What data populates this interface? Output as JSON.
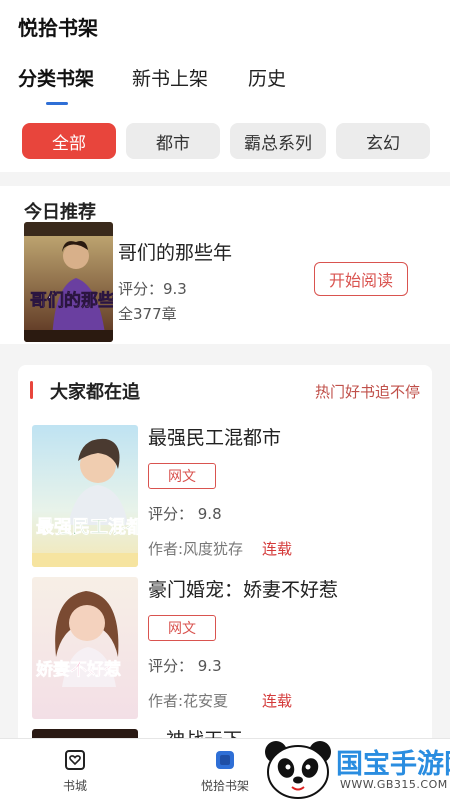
{
  "app": {
    "title": "悦拾书架"
  },
  "tabs": [
    {
      "label": "分类书架",
      "active": true
    },
    {
      "label": "新书上架",
      "active": false
    },
    {
      "label": "历史",
      "active": false
    }
  ],
  "categories": [
    {
      "label": "全部",
      "active": true
    },
    {
      "label": "都市",
      "active": false
    },
    {
      "label": "霸总系列",
      "active": false
    },
    {
      "label": "玄幻",
      "active": false
    }
  ],
  "recommend": {
    "section_title": "今日推荐",
    "book": {
      "title": "哥们的那些年",
      "score": "评分：9.3",
      "chapters": "全377章",
      "cover_text": "哥们的那些年"
    },
    "read_button": "开始阅读"
  },
  "hot": {
    "section_title": "大家都在追",
    "link": "热门好书追不停",
    "books": [
      {
        "title": "最强民工混都市",
        "tag": "网文",
        "score": "评分：  9.8",
        "author": "作者:风度犹存",
        "status": "连载",
        "cover_text": "最强民工混都市"
      },
      {
        "title": "豪门婚宠：娇妻不好惹",
        "tag": "网文",
        "score": "评分：  9.3",
        "author": "作者:花安夏",
        "status": "连载",
        "cover_text": "娇妻不好惹"
      }
    ],
    "partial_title": "神战天下"
  },
  "bottom_nav": [
    {
      "label": "书城",
      "icon": "heart-book-icon",
      "active": false
    },
    {
      "label": "悦拾书架",
      "icon": "bookshelf-icon",
      "active": true
    }
  ],
  "watermark": {
    "text": "国宝手游网",
    "url": "WWW.GB315.COM"
  },
  "colors": {
    "accent": "#e8453c",
    "tab_indicator": "#2f6fd6",
    "tag": "#d9534f",
    "watermark": "#2a8de0"
  }
}
